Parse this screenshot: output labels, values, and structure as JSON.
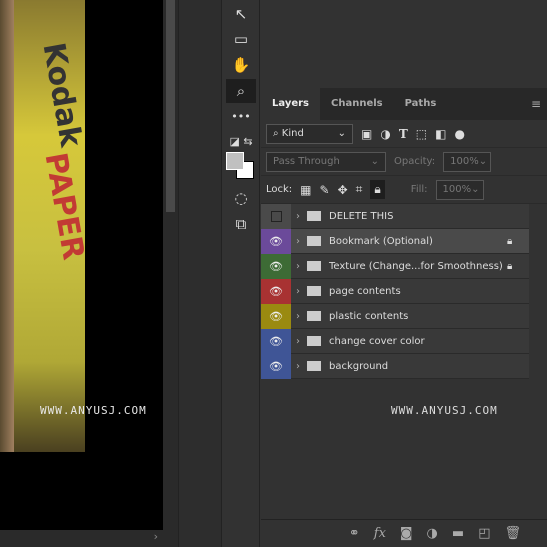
{
  "canvas": {
    "cover_text_1": "Kodak",
    "cover_text_2": "PAPER",
    "watermark": "WWW.ANYUSJ.COM"
  },
  "tools": [
    {
      "icon": "move-arrow-icon",
      "g": "➤"
    },
    {
      "icon": "rectangle-marquee-icon",
      "g": "▭"
    },
    {
      "icon": "hand-icon",
      "g": "✋"
    },
    {
      "icon": "zoom-icon",
      "g": "⌕"
    },
    {
      "icon": "more-tools-icon",
      "g": "•••"
    },
    {
      "icon": "quick-mask-icon",
      "g": "◌"
    },
    {
      "icon": "screen-mode-icon",
      "g": "⧉"
    }
  ],
  "colors": {
    "foreground": "#c0c0c0",
    "background": "#ffffff"
  },
  "panel": {
    "tabs": [
      "Layers",
      "Channels",
      "Paths"
    ],
    "filter": {
      "label": "Kind"
    },
    "blend_mode": "Pass Through",
    "opacity_label": "Opacity:",
    "opacity": "100%",
    "lock_label": "Lock:",
    "fill_label": "Fill:",
    "fill": "100%",
    "layers": [
      {
        "name": "DELETE THIS",
        "color": "#4a4a4a",
        "visible": false,
        "locked": false
      },
      {
        "name": "Bookmark (Optional)",
        "color": "#6b4a9a",
        "visible": true,
        "locked": true,
        "selected": true
      },
      {
        "name": "Texture (Change...for Smoothness)",
        "color": "#3d6b35",
        "visible": true,
        "locked": true
      },
      {
        "name": "page contents",
        "color": "#a83232",
        "visible": true,
        "locked": false
      },
      {
        "name": "plastic contents",
        "color": "#9a8a10",
        "visible": true,
        "locked": false
      },
      {
        "name": "change cover color",
        "color": "#3f5596",
        "visible": true,
        "locked": false
      },
      {
        "name": "background",
        "color": "#3f5596",
        "visible": true,
        "locked": false
      }
    ],
    "watermark": "WWW.ANYUSJ.COM"
  }
}
